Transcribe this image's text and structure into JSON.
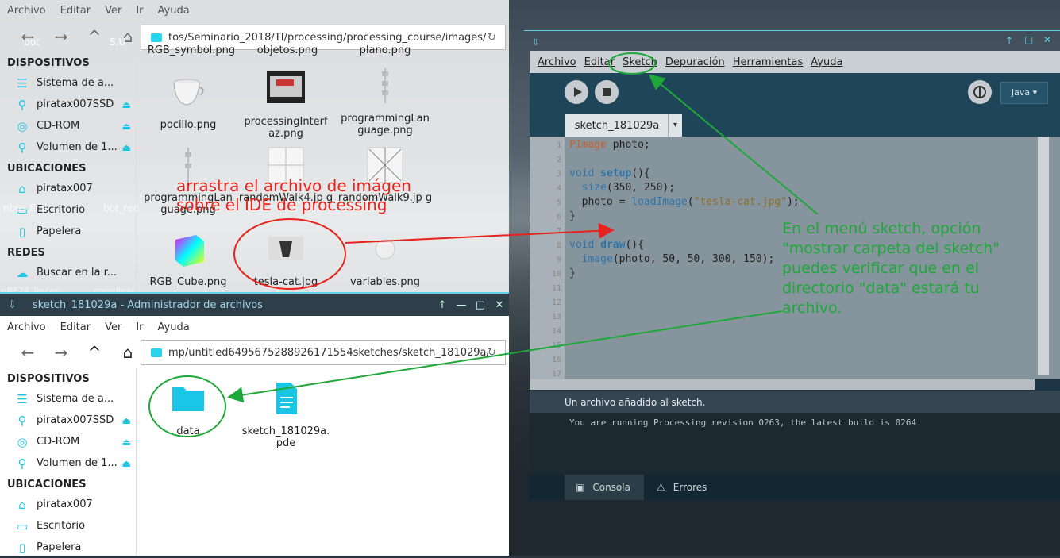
{
  "top_fm": {
    "menu": [
      "Archivo",
      "Editar",
      "Ver",
      "Ir",
      "Ayuda"
    ],
    "location": "tos/Seminario_2018/TI/processing/processing_course/images/",
    "sections": {
      "devices": "DISPOSITIVOS",
      "places": "UBICACIONES",
      "networks": "REDES"
    },
    "devices": [
      "Sistema de a...",
      "piratax007SSD",
      "CD-ROM",
      "Volumen de 1..."
    ],
    "places": [
      "piratax007",
      "Escritorio",
      "Papelera"
    ],
    "networks": [
      "Buscar en la r..."
    ],
    "clipped_row": [
      "RGB_symbol.png",
      "objetos.png",
      "plano.png"
    ],
    "files": [
      "pocillo.png",
      "processingInterf az.png",
      "programmingLan guage.png",
      "programmingLan guage.png",
      "randomWalk4.jp g",
      "randomWalk9.jp g",
      "RGB_Cube.png",
      "tesla-cat.jpg",
      "variables.png"
    ]
  },
  "bottom_fm": {
    "title": "sketch_181029a - Administrador de archivos",
    "menu": [
      "Archivo",
      "Editar",
      "Ver",
      "Ir",
      "Ayuda"
    ],
    "location": "mp/untitled6495675288926171554sketches/sketch_181029a/",
    "sections": {
      "devices": "DISPOSITIVOS",
      "places": "UBICACIONES"
    },
    "devices": [
      "Sistema de a...",
      "piratax007SSD",
      "CD-ROM",
      "Volumen de 1..."
    ],
    "places": [
      "piratax007",
      "Escritorio",
      "Papelera"
    ],
    "files": [
      "data",
      "sketch_181029a. pde"
    ]
  },
  "desktop": {
    "labels": [
      "bot",
      "S.U",
      "nbus Emi",
      "bot_rec",
      "nRF24_Recep",
      "coordinat"
    ]
  },
  "ide": {
    "menu": [
      "Archivo",
      "Editar",
      "Sketch",
      "Depuración",
      "Herramientas",
      "Ayuda"
    ],
    "mode": "Java ▾",
    "tab": "sketch_181029a",
    "tab_dropdown": "▾",
    "lines": [
      "1",
      "2",
      "3",
      "4",
      "5",
      "6",
      "7",
      "8",
      "9",
      "10",
      "11",
      "12",
      "13",
      "14",
      "15",
      "16",
      "17"
    ],
    "code": {
      "l1a": "PImage",
      "l1b": " photo;",
      "l3a": "void ",
      "l3b": "setup",
      "l3c": "(){",
      "l4a": "  ",
      "l4b": "size",
      "l4c": "(350, 250);",
      "l5a": "  photo = ",
      "l5b": "loadImage",
      "l5c": "(",
      "l5d": "\"tesla-cat.jpg\"",
      "l5e": ");",
      "l6": "}",
      "l8a": "void ",
      "l8b": "draw",
      "l8c": "(){",
      "l9a": "  ",
      "l9b": "image",
      "l9c": "(photo, 50, 50, 300, 150);",
      "l10": "}"
    },
    "status": "Un archivo añadido al sketch.",
    "console": "You are running Processing revision 0263, the latest build is 0264.",
    "console_tab": "Consola",
    "errors_tab": "Errores"
  },
  "annotations": {
    "drag": [
      "arrastra el archivo de imágen",
      "sobre el IDE de processing"
    ],
    "menu_hint": [
      "En el menú sketch, opción",
      "\"mostrar carpeta del sketch\"",
      "puedes verificar que en el",
      "directorio \"data\" estará tu",
      "archivo."
    ]
  },
  "colors": {
    "accent": "#19c6e6",
    "red": "#e8221c",
    "green": "#1fa83a"
  }
}
